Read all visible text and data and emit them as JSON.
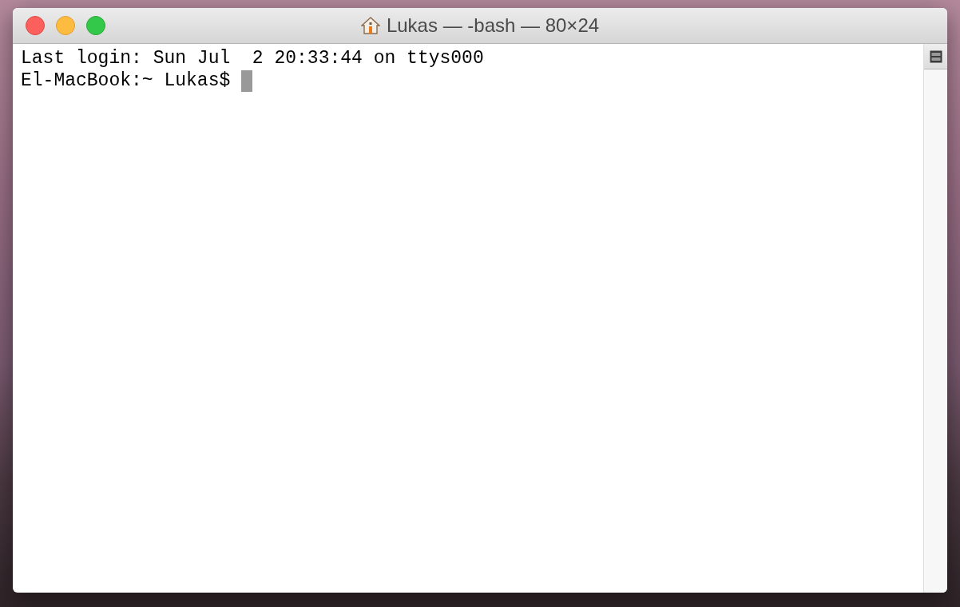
{
  "window": {
    "title": "Lukas — -bash — 80×24"
  },
  "terminal": {
    "lines": [
      "Last login: Sun Jul  2 20:33:44 on ttys000"
    ],
    "prompt": "El-MacBook:~ Lukas$ "
  }
}
